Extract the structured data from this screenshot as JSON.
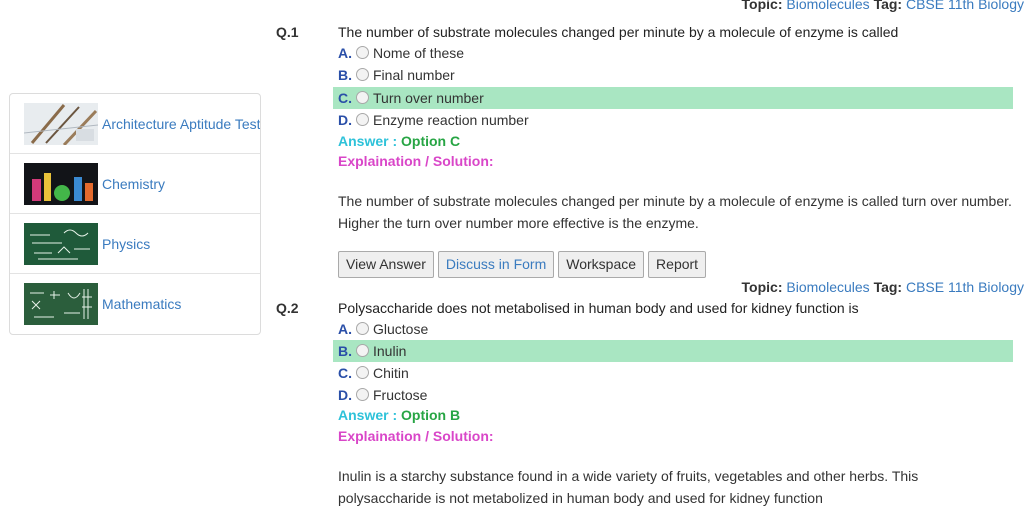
{
  "sidebar": {
    "items": [
      {
        "label": "Architecture Aptitude Test",
        "icon": "architecture-thumbnail"
      },
      {
        "label": "Chemistry",
        "icon": "chemistry-thumbnail"
      },
      {
        "label": "Physics",
        "icon": "physics-thumbnail"
      },
      {
        "label": "Mathematics",
        "icon": "mathematics-thumbnail"
      }
    ]
  },
  "questions": [
    {
      "topic_label": "Topic:",
      "topic": "Biomolecules",
      "tag_label": "Tag:",
      "tag": "CBSE 11th Biology",
      "number": "Q.1",
      "text": "The number of substrate molecules changed per minute by a molecule of enzyme is called",
      "options": [
        {
          "letter": "A.",
          "text": "Nome of these"
        },
        {
          "letter": "B.",
          "text": "Final number"
        },
        {
          "letter": "C.",
          "text": "Turn over number"
        },
        {
          "letter": "D.",
          "text": "Enzyme reaction number"
        }
      ],
      "answer_label": "Answer :",
      "answer_value": "Option C",
      "explanation_label": "Explaination / Solution:",
      "solution": "The number of substrate molecules changed per minute by a molecule of enzyme is called turn over number. Higher the turn over number more effective is the enzyme."
    },
    {
      "topic_label": "Topic:",
      "topic": "Biomolecules",
      "tag_label": "Tag:",
      "tag": "CBSE 11th Biology",
      "number": "Q.2",
      "text": "Polysaccharide does not metabolised in human body and used for kidney function is",
      "options": [
        {
          "letter": "A.",
          "text": "Gluctose"
        },
        {
          "letter": "B.",
          "text": "Inulin"
        },
        {
          "letter": "C.",
          "text": "Chitin"
        },
        {
          "letter": "D.",
          "text": "Fructose"
        }
      ],
      "answer_label": "Answer :",
      "answer_value": "Option B",
      "explanation_label": "Explaination / Solution:",
      "solution": "Inulin is a starchy substance found in a wide variety of fruits, vegetables and other herbs. This polysaccharide is not metabolized in human body and used for kidney function"
    }
  ],
  "buttons": {
    "view_answer": "View Answer",
    "discuss": "Discuss in Form",
    "workspace": "Workspace",
    "report": "Report"
  },
  "colors": {
    "correct_highlight": "#a9e6c2",
    "answer_label": "#2ec2d9",
    "answer_value": "#27a544",
    "explanation": "#d946c8",
    "link": "#3a7bbf"
  }
}
